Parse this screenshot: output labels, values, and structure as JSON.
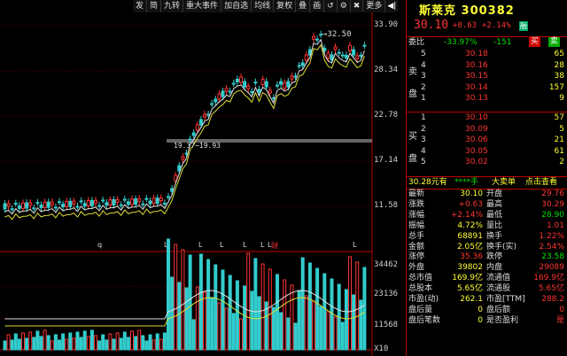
{
  "toolbar": {
    "items": [
      "发",
      "简",
      "九转",
      "重大事件",
      "加自选",
      "均线",
      "复权",
      "叠",
      "画",
      "↺",
      "⚙",
      "✖",
      "更多"
    ],
    "arrow": "◀|"
  },
  "price_axis": [
    "33.90",
    "28.34",
    "22.78",
    "17.14",
    "11.58"
  ],
  "volume_axis": [
    "34462",
    "23136",
    "11568",
    "X10"
  ],
  "annotations": {
    "high_marker": "32.50",
    "low_marker": "19.37−19.93",
    "date_markers": [
      "q",
      "L",
      "L",
      "L",
      "L",
      "L",
      "L",
      "财",
      "L"
    ]
  },
  "panel": {
    "title": "斯莱克 300382",
    "price": "30.10",
    "change": "+0.63",
    "change_pct": "+2.14%",
    "flag": "融",
    "committee": {
      "label": "委比",
      "ratio": "-33.97%",
      "diff": "-151",
      "buy_btn": "买",
      "sell_btn": "卖"
    },
    "sell_label": [
      "卖",
      "盘"
    ],
    "buy_label": [
      "买",
      "盘"
    ],
    "asks": [
      {
        "level": "5",
        "price": "30.18",
        "vol": "65"
      },
      {
        "level": "4",
        "price": "30.16",
        "vol": "28"
      },
      {
        "level": "3",
        "price": "30.15",
        "vol": "38"
      },
      {
        "level": "2",
        "price": "30.14",
        "vol": "157"
      },
      {
        "level": "1",
        "price": "30.13",
        "vol": "9"
      }
    ],
    "bids": [
      {
        "level": "1",
        "price": "30.10",
        "vol": "57"
      },
      {
        "level": "2",
        "price": "30.09",
        "vol": "5"
      },
      {
        "level": "3",
        "price": "30.06",
        "vol": "21"
      },
      {
        "level": "4",
        "price": "30.05",
        "vol": "61"
      },
      {
        "level": "5",
        "price": "30.02",
        "vol": "2"
      }
    ],
    "bar": {
      "price": "30.28元有",
      "stars": "****手",
      "big": "大卖单",
      "link": "点击查看"
    },
    "stats": [
      {
        "l1": "最新",
        "v1": "30.10",
        "l2": "开盘",
        "v2": "29.76"
      },
      {
        "l1": "涨跌",
        "v1": "+0.63",
        "l2": "最高",
        "v2": "30.29"
      },
      {
        "l1": "涨幅",
        "v1": "+2.14%",
        "l2": "最低",
        "v2": "28.90"
      },
      {
        "l1": "振幅",
        "v1": "4.72%",
        "l2": "量比",
        "v2": "1.01"
      },
      {
        "l1": "总手",
        "v1": "68891",
        "l2": "换手",
        "v2": "1.22%"
      },
      {
        "l1": "金额",
        "v1": "2.05亿",
        "l2": "换手(实)",
        "v2": "2.54%"
      },
      {
        "l1": "涨停",
        "v1": "35.36",
        "l2": "跌停",
        "v2": "23.58"
      },
      {
        "l1": "外盘",
        "v1": "39802",
        "l2": "内盘",
        "v2": "29089"
      },
      {
        "l1": "总市值",
        "v1": "169.9亿",
        "l2": "流通值",
        "v2": "169.9亿"
      },
      {
        "l1": "总股本",
        "v1": "5.65亿",
        "l2": "流通股",
        "v2": "5.65亿"
      },
      {
        "l1": "市盈(动)",
        "v1": "262.1",
        "l2": "市盈[TTM]",
        "v2": "288.2"
      },
      {
        "l1": "盘后量",
        "v1": "0",
        "l2": "盘后额",
        "v2": "0"
      },
      {
        "l1": "盘后笔数",
        "v1": "0",
        "l2": "是否盈利",
        "v2": "是"
      }
    ]
  }
}
